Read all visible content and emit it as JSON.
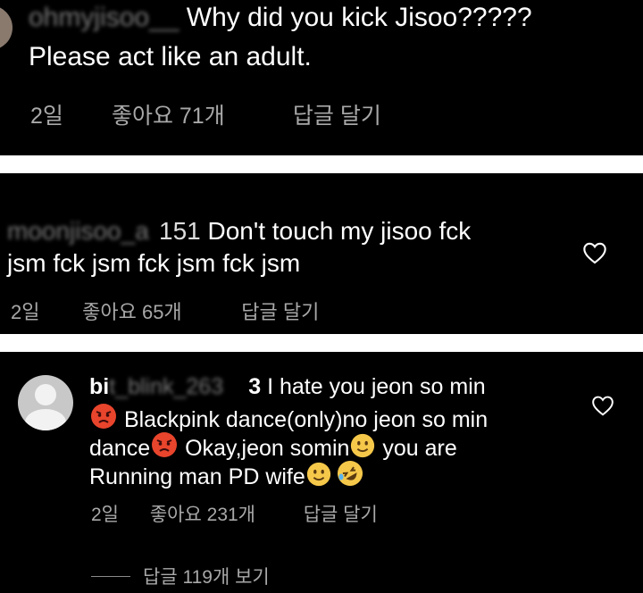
{
  "comments": [
    {
      "username": "ohmyjisoo__",
      "text": "Why did you kick Jisoo?????",
      "text2": "Please act like an adult.",
      "time": "2일",
      "likes": "좋아요 71개",
      "reply": "답글 달기"
    },
    {
      "username": "moonjisoo_a151",
      "username_visible": "151",
      "text": " Don't touch my jisoo fck",
      "text2": "jsm fck jsm fck jsm fck jsm",
      "time": "2일",
      "likes": "좋아요 65개",
      "reply": "답글 달기"
    },
    {
      "username_visible_start": "bi",
      "username_hidden": "t_blink_263",
      "username_visible_end": "3",
      "text": " I hate you jeon so min",
      "line2": " Blackpink dance(only)no jeon so min",
      "line3_a": "dance",
      "line3_b": " Okay,jeon somin",
      "line3_c": "  you are",
      "line4": "Running man PD wife",
      "time": "2일",
      "likes": "좋아요 231개",
      "reply": "답글 달기",
      "view_replies": "답글 119개 보기"
    }
  ],
  "icons": {
    "heart": "heart-outline-icon",
    "angry": "angry-face-emoji",
    "smile": "slightly-smiling-face-emoji",
    "rofl": "rolling-on-floor-laughing-emoji"
  }
}
